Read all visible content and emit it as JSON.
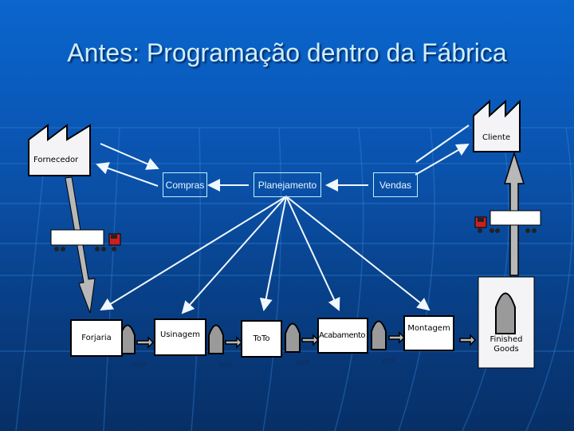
{
  "slide": {
    "title": "Antes: Programação dentro da Fábrica"
  },
  "entities": {
    "supplier": "Fornecedor",
    "customer": "Cliente"
  },
  "management": {
    "purchasing": "Compras",
    "planning": "Planejamento",
    "sales": "Vendas"
  },
  "processes": [
    {
      "label": "Forjaria"
    },
    {
      "label": "Usinagem"
    },
    {
      "label": "ToTo"
    },
    {
      "label": "Acabamento"
    },
    {
      "label": "Montagem"
    }
  ],
  "inventory": {
    "wip_labels": [
      "WIP",
      "WIP",
      "WIP",
      "WIP"
    ],
    "finished_goods": "Finished Goods"
  },
  "colors": {
    "background": "#0a5cbf",
    "title_text": "#cdeefc",
    "arrow_line": "#f0f8ff",
    "inventory_fill": "#9a9a9a",
    "truck_cab": "#cc2020"
  }
}
